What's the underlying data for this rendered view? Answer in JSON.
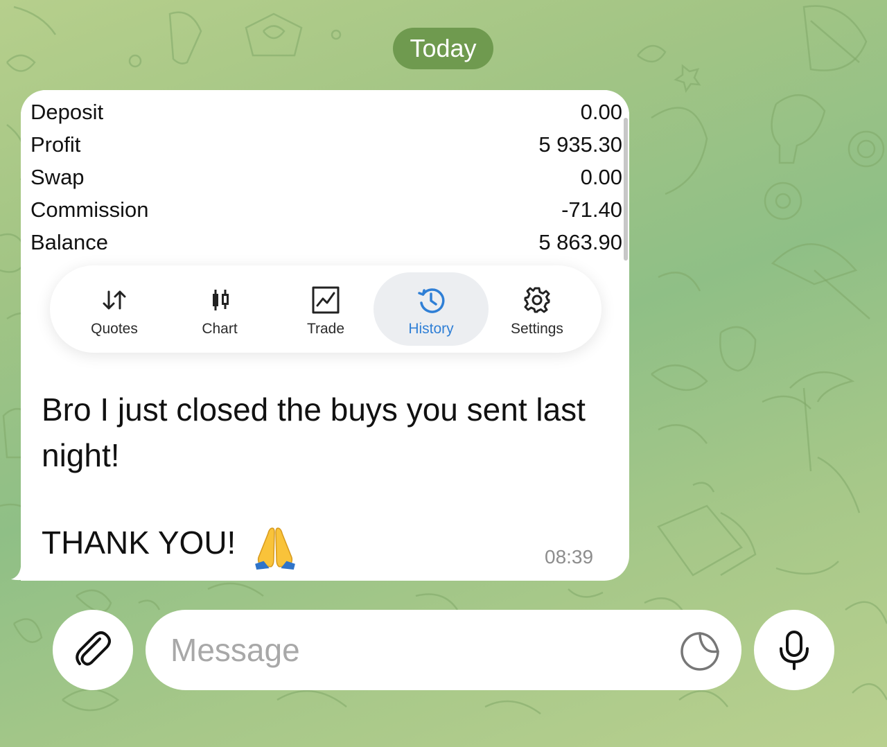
{
  "date_separator": "Today",
  "message": {
    "screenshot": {
      "stats": [
        {
          "label": "Deposit",
          "value": "0.00"
        },
        {
          "label": "Profit",
          "value": "5 935.30"
        },
        {
          "label": "Swap",
          "value": "0.00"
        },
        {
          "label": "Commission",
          "value": "-71.40"
        },
        {
          "label": "Balance",
          "value": "5 863.90"
        }
      ],
      "tabs": [
        {
          "label": "Quotes",
          "icon": "quotes-arrows-icon"
        },
        {
          "label": "Chart",
          "icon": "candlestick-icon"
        },
        {
          "label": "Trade",
          "icon": "trade-chart-icon"
        },
        {
          "label": "History",
          "icon": "history-clock-icon",
          "active": true
        },
        {
          "label": "Settings",
          "icon": "gear-icon"
        }
      ]
    },
    "text": "Bro I just closed the buys you sent last night!",
    "thanks": "THANK YOU!",
    "emoji": "folded-hands-emoji",
    "time": "08:39"
  },
  "composer": {
    "placeholder": "Message",
    "attach_icon": "paperclip-icon",
    "sticker_icon": "sticker-icon",
    "mic_icon": "microphone-icon"
  },
  "colors": {
    "date_pill": "#6f9a4f",
    "active_tab": "#2f7fd6",
    "timestamp": "#8d8d8d",
    "placeholder": "#a8a8a8"
  }
}
